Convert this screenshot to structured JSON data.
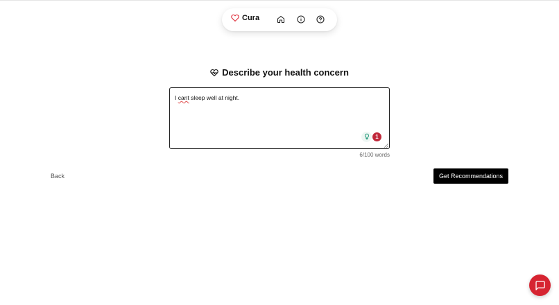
{
  "nav": {
    "brand": "Cura",
    "brand_icon": "heart-outline",
    "accent_color": "#e0313d",
    "items": [
      {
        "name": "home",
        "icon": "home-icon",
        "active": true
      },
      {
        "name": "info",
        "icon": "info-icon",
        "active": false
      },
      {
        "name": "help",
        "icon": "help-icon",
        "active": false
      }
    ]
  },
  "main": {
    "heading": "Describe your health concern",
    "heading_icon": "heart-pulse-icon",
    "textarea": {
      "value_misspelled": "cant",
      "value_prefix": "I ",
      "value_suffix": " sleep well at night.",
      "suggestion_count": "1"
    },
    "word_count": "6/100 words",
    "back_label": "Back",
    "submit_label": "Get Recommendations"
  },
  "chat": {
    "icon": "chat-bubble-icon",
    "color": "#d62431"
  }
}
